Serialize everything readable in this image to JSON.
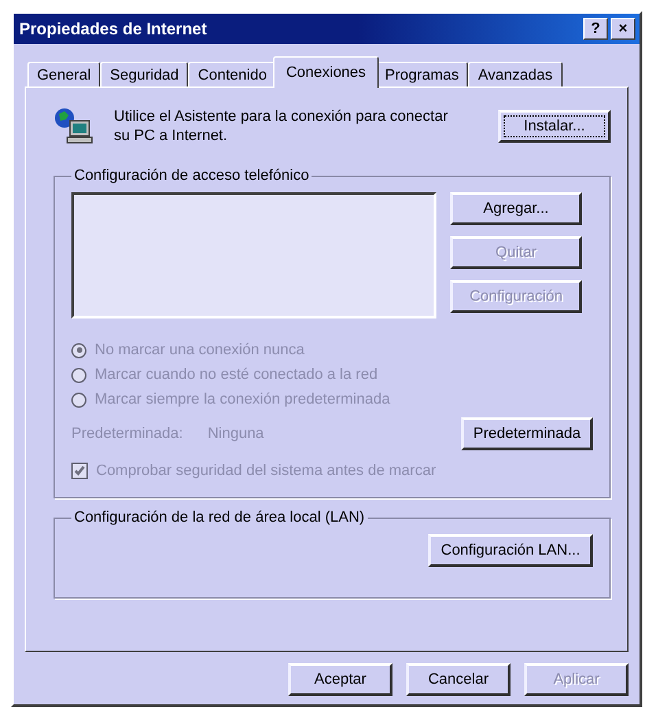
{
  "window": {
    "title": "Propiedades de Internet",
    "controls": [
      "?",
      "×"
    ]
  },
  "tabs": [
    {
      "label": "General",
      "selected": false
    },
    {
      "label": "Seguridad",
      "selected": false
    },
    {
      "label": "Contenido",
      "selected": false
    },
    {
      "label": "Conexiones",
      "selected": true
    },
    {
      "label": "Programas",
      "selected": false
    },
    {
      "label": "Avanzadas",
      "selected": false
    }
  ],
  "wizard": {
    "text": "Utilice el Asistente para la conexión para conectar su PC a Internet.",
    "button": "Instalar..."
  },
  "dialup": {
    "title": "Configuración de acceso telefónico",
    "buttons": [
      {
        "label": "Agregar...",
        "disabled": false
      },
      {
        "label": "Quitar",
        "disabled": true
      },
      {
        "label": "Configuración",
        "disabled": true
      }
    ],
    "options": [
      {
        "label": "No marcar una conexión nunca",
        "selected": true,
        "disabled": true
      },
      {
        "label": "Marcar cuando no esté conectado a la red",
        "selected": false,
        "disabled": true
      },
      {
        "label": "Marcar siempre la conexión predeterminada",
        "selected": false,
        "disabled": true
      }
    ],
    "default_label": "Predeterminada:",
    "default_value": "Ninguna",
    "default_button": "Predeterminada",
    "check": {
      "label": "Comprobar seguridad del sistema antes de marcar",
      "checked": true,
      "disabled": true
    }
  },
  "lan": {
    "title": "Configuración de la red de área local (LAN)",
    "button": "Configuración LAN..."
  },
  "footer": [
    {
      "label": "Aceptar",
      "disabled": false
    },
    {
      "label": "Cancelar",
      "disabled": false
    },
    {
      "label": "Aplicar",
      "disabled": true
    }
  ]
}
